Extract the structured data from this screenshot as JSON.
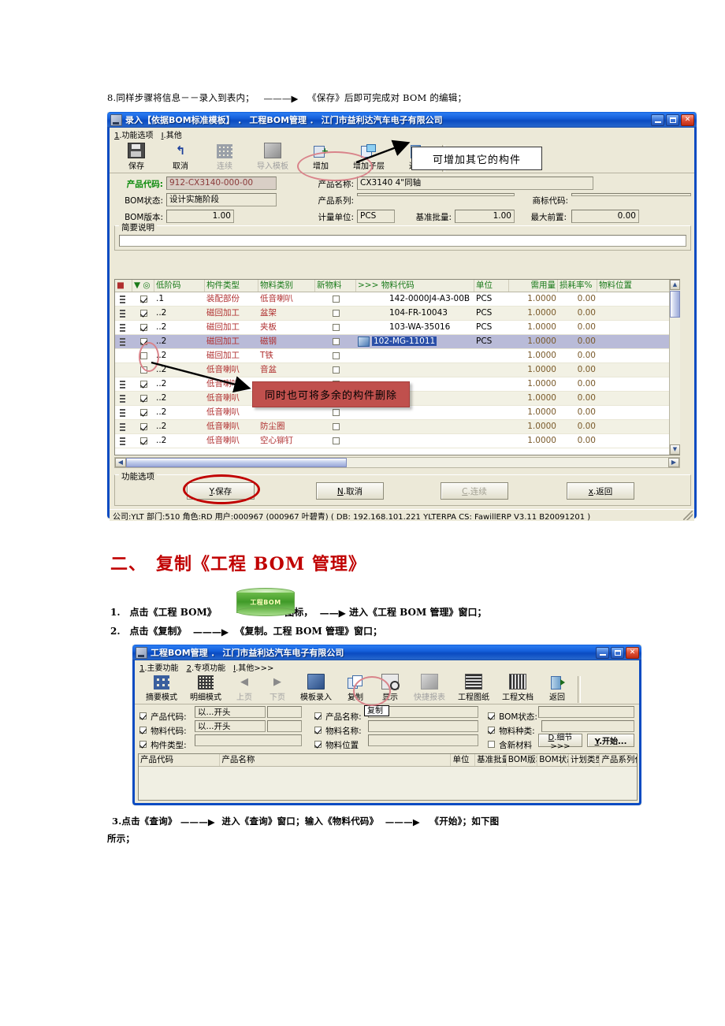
{
  "doc": {
    "step8": "8.同样步骤将信息－－录入到表内；",
    "step8_tail": "《保存》后即可完成对 BOM 的编辑；",
    "section2_title": "二、　复制《工程 BOM 管理》",
    "item1_a": "1.　点击《工程 BOM》",
    "item1_b": "图标，",
    "item1_c": "进入《工程 BOM 管理》窗口；",
    "item2_a": "2.　点击《复制》",
    "item2_b": "《复制。工程 BOM 管理》窗口；",
    "step3_line1_a": "3.点击《查询》",
    "step3_line1_b": "进入《查询》窗口；输入《物料代码》",
    "step3_line1_c": "《开始》；如下图",
    "step3_line2": "所示；",
    "bom_icon_label": "工程BOM"
  },
  "win1": {
    "title": "录入【依据BOM标准模板】 ． 工程BOM管理 ． 江门市益利达汽车电子有限公司",
    "menu": [
      {
        "accel": "1",
        "label": ".功能选项"
      },
      {
        "accel": "I",
        "label": ".其他"
      }
    ],
    "toolbar": [
      {
        "label": "保存",
        "icon": "save-icon",
        "disabled": false
      },
      {
        "label": "取消",
        "icon": "undo-icon",
        "disabled": false
      },
      {
        "label": "连续",
        "icon": "grid-icon",
        "disabled": true
      },
      {
        "label": "导入模板",
        "icon": "import-template-icon",
        "disabled": true
      },
      {
        "label": "增加",
        "icon": "add-icon",
        "disabled": false
      },
      {
        "label": "增加子层",
        "icon": "add-sublevel-icon",
        "disabled": false
      },
      {
        "label": "返回",
        "icon": "exit-icon",
        "disabled": false
      }
    ],
    "fields": {
      "product_code_label": "产品代码:",
      "product_code_value": "912-CX3140-000-00",
      "product_name_label": "产品名称:",
      "product_name_value": "CX3140 4\"同轴",
      "bom_status_label": "BOM状态:",
      "bom_status_value": "设计实施阶段",
      "product_series_label": "产品系列:",
      "product_series_value": "",
      "brand_code_label": "商标代码:",
      "brand_code_value": "",
      "bom_version_label": "BOM版本:",
      "bom_version_value": "1.00",
      "unit_label": "计量单位:",
      "unit_value": "PCS",
      "base_lot_label": "基准批量:",
      "base_lot_value": "1.00",
      "max_lead_label": "最大前置:",
      "max_lead_value": "0.00",
      "brief_group_title": "简要说明",
      "brief_value": ""
    },
    "grid": {
      "columns": [
        "",
        "",
        "低阶码",
        "构件类型",
        "物料类别",
        "新物料",
        ">>> 物料代码",
        "单位",
        "需用量",
        "损耗率%",
        "物料位置"
      ],
      "rows": [
        {
          "checked": true,
          "tree": true,
          "level": ".1",
          "ctype": "装配部份",
          "mclass": "低音喇叭",
          "newmat": false,
          "code": "142-0000J4-A3-00B",
          "unit": "PCS",
          "qty": "1.0000",
          "loss": "0.00",
          "pos": "",
          "selected": false,
          "editing": false
        },
        {
          "checked": true,
          "tree": true,
          "level": "..2",
          "ctype": "磁回加工",
          "mclass": "盆架",
          "newmat": false,
          "code": "104-FR-10043",
          "unit": "PCS",
          "qty": "1.0000",
          "loss": "0.00",
          "pos": "",
          "selected": false,
          "editing": false
        },
        {
          "checked": true,
          "tree": true,
          "level": "..2",
          "ctype": "磁回加工",
          "mclass": "夹板",
          "newmat": false,
          "code": "103-WA-35016",
          "unit": "PCS",
          "qty": "1.0000",
          "loss": "0.00",
          "pos": "",
          "selected": false,
          "editing": false
        },
        {
          "checked": true,
          "tree": true,
          "level": "..2",
          "ctype": "磁回加工",
          "mclass": "磁钢",
          "newmat": false,
          "code": "102-MG-11011",
          "unit": "PCS",
          "qty": "1.0000",
          "loss": "0.00",
          "pos": "",
          "selected": true,
          "editing": true
        },
        {
          "checked": false,
          "tree": false,
          "level": "..2",
          "ctype": "磁回加工",
          "mclass": "T铁",
          "newmat": false,
          "code": "",
          "unit": "",
          "qty": "1.0000",
          "loss": "0.00",
          "pos": "",
          "selected": false,
          "editing": false
        },
        {
          "checked": false,
          "tree": false,
          "level": "..2",
          "ctype": "低音喇叭",
          "mclass": "音盆",
          "newmat": false,
          "code": "",
          "unit": "",
          "qty": "1.0000",
          "loss": "0.00",
          "pos": "",
          "selected": false,
          "editing": false
        },
        {
          "checked": true,
          "tree": true,
          "level": "..2",
          "ctype": "低音喇叭",
          "mclass": "",
          "newmat": false,
          "code": "",
          "unit": "",
          "qty": "1.0000",
          "loss": "0.00",
          "pos": "",
          "selected": false,
          "editing": false
        },
        {
          "checked": true,
          "tree": true,
          "level": "..2",
          "ctype": "低音喇叭",
          "mclass": "",
          "newmat": false,
          "code": "",
          "unit": "",
          "qty": "1.0000",
          "loss": "0.00",
          "pos": "",
          "selected": false,
          "editing": false
        },
        {
          "checked": true,
          "tree": true,
          "level": "..2",
          "ctype": "低音喇叭",
          "mclass": "",
          "newmat": false,
          "code": "",
          "unit": "",
          "qty": "1.0000",
          "loss": "0.00",
          "pos": "",
          "selected": false,
          "editing": false
        },
        {
          "checked": true,
          "tree": true,
          "level": "..2",
          "ctype": "低音喇叭",
          "mclass": "防尘圈",
          "newmat": false,
          "code": "",
          "unit": "",
          "qty": "1.0000",
          "loss": "0.00",
          "pos": "",
          "selected": false,
          "editing": false
        },
        {
          "checked": true,
          "tree": true,
          "level": "..2",
          "ctype": "低音喇叭",
          "mclass": "空心铆钉",
          "newmat": false,
          "code": "",
          "unit": "",
          "qty": "1.0000",
          "loss": "0.00",
          "pos": "",
          "selected": false,
          "editing": false
        }
      ]
    },
    "footer": {
      "group_title": "功能选项",
      "buttons": [
        {
          "accel": "Y",
          "label": ".保存",
          "disabled": false
        },
        {
          "accel": "N",
          "label": ".取消",
          "disabled": false
        },
        {
          "accel": "C",
          "label": ".连续",
          "disabled": true
        },
        {
          "accel": "x",
          "label": ".返回",
          "disabled": false
        }
      ]
    },
    "statusbar": "公司:YLT  部门:510  角色:RD  用户:000967 (000967 叶碧青)  ( DB: 192.168.101.221 YLTERPA   CS: FawillERP V3.11 B20091201 )"
  },
  "win2": {
    "title": "工程BOM管理 ． 江门市益利达汽车电子有限公司",
    "menu": [
      {
        "accel": "1",
        "label": ".主要功能"
      },
      {
        "accel": "2",
        "label": ".专项功能"
      },
      {
        "accel": "I",
        "label": ".其他>>>"
      }
    ],
    "toolbar": [
      {
        "label": "摘要模式",
        "icon": "summary-mode-icon",
        "disabled": false
      },
      {
        "label": "明细模式",
        "icon": "detail-mode-icon",
        "disabled": false
      },
      {
        "label": "上页",
        "icon": "prev-page-icon",
        "disabled": true
      },
      {
        "label": "下页",
        "icon": "next-page-icon",
        "disabled": true
      },
      {
        "label": "模板录入",
        "icon": "template-entry-icon",
        "disabled": false
      },
      {
        "label": "复制",
        "icon": "copy-icon",
        "disabled": false
      },
      {
        "label": "显示",
        "icon": "show-icon",
        "disabled": false
      },
      {
        "label": "快捷报表",
        "icon": "quick-report-icon",
        "disabled": true
      },
      {
        "label": "工程图纸",
        "icon": "drawing-icon",
        "disabled": false
      },
      {
        "label": "工程文档",
        "icon": "document-icon",
        "disabled": false
      },
      {
        "label": "返回",
        "icon": "exit-icon",
        "disabled": false
      }
    ],
    "filters": [
      {
        "checked": true,
        "label": "产品代码:",
        "value": "以...开头",
        "extra": ""
      },
      {
        "checked": true,
        "label": "物料代码:",
        "value": "以...开头",
        "extra": ""
      },
      {
        "checked": true,
        "label": "构件类型:",
        "value": "",
        "extra": ""
      },
      {
        "checked": true,
        "label": "产品名称:",
        "value": "",
        "extra": ""
      },
      {
        "checked": true,
        "label": "物料名称:",
        "value": "",
        "extra": ""
      },
      {
        "checked": true,
        "label": "物料位置",
        "value": "",
        "extra": ""
      },
      {
        "checked": true,
        "label": "BOM状态:",
        "value": "",
        "extra": ""
      },
      {
        "checked": true,
        "label": "物料种类:",
        "value": "",
        "extra": ""
      },
      {
        "checked": false,
        "label": "含新材料",
        "value": "",
        "extra": ""
      }
    ],
    "tooltip": "复制",
    "buttons": [
      {
        "accel": "D",
        "label": ".细节>>>"
      },
      {
        "accel": "Y",
        "label": ".开始..."
      }
    ],
    "grid_columns": [
      "产品代码",
      "产品名称",
      "单位",
      "基准批量",
      "BOM版本",
      "BOM状态",
      "计划类型",
      "产品系列代"
    ]
  },
  "annotations": {
    "add_component": "可增加其它的构件",
    "delete_extra": "同时也可将多余的构件删除"
  },
  "colors": {
    "titlebar_blue": "#0a4bc2",
    "window_face": "#ece9d8",
    "grid_header_green": "#1a7a1a",
    "row_red": "#b03030",
    "callout_red": "#c0504d",
    "heading_red": "#c00000",
    "selection": "#b9bbd8"
  }
}
